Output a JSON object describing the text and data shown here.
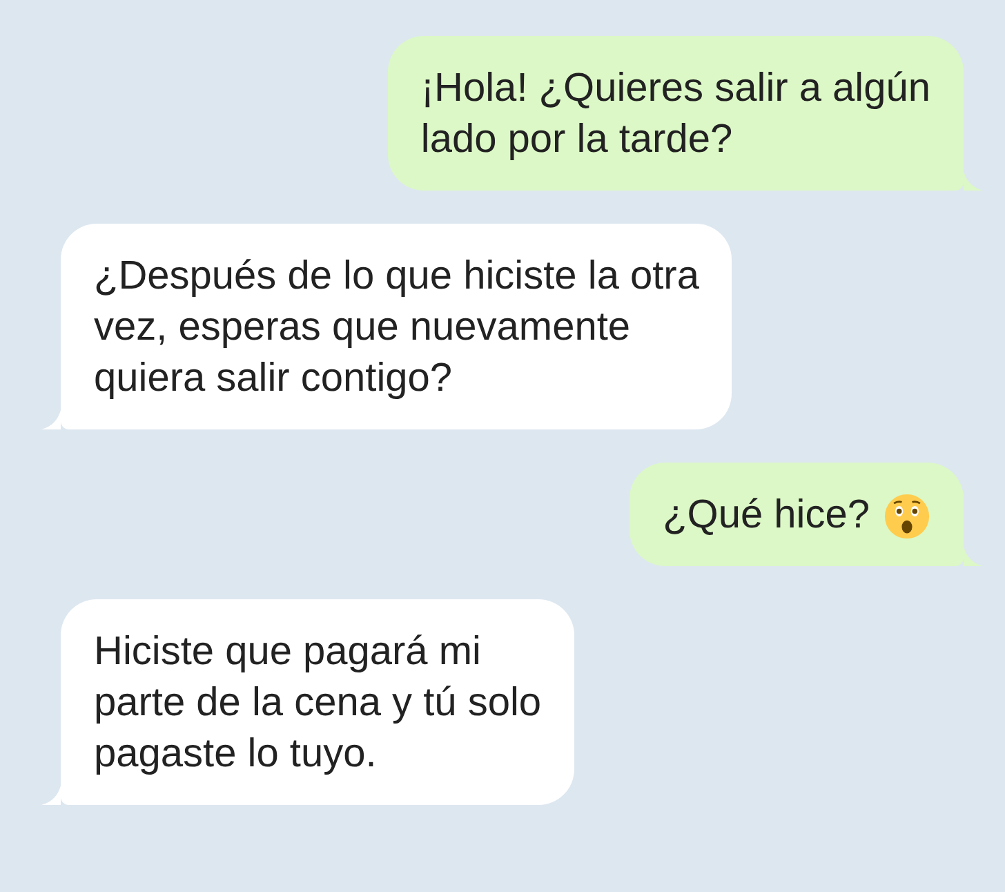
{
  "messages": [
    {
      "kind": "sent",
      "lines": [
        "¡Hola! ¿Quieres salir a algún",
        "lado por la tarde?"
      ],
      "emoji": false
    },
    {
      "kind": "received",
      "lines": [
        "¿Después de lo que hiciste la otra",
        "vez, esperas que nuevamente",
        "quiera salir contigo?"
      ],
      "emoji": false
    },
    {
      "kind": "sent",
      "lines": [
        "¿Qué hice?"
      ],
      "emoji": true
    },
    {
      "kind": "received",
      "lines": [
        "Hiciste que pagará mi",
        "parte de la cena y tú solo",
        "pagaste lo tuyo."
      ],
      "emoji": false
    }
  ]
}
